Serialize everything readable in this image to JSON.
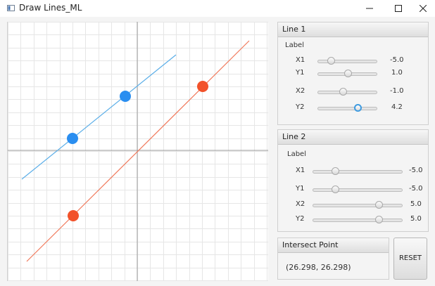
{
  "window": {
    "title": "Draw Lines_ML"
  },
  "line1": {
    "title": "Line 1",
    "label": "Label",
    "color": "#2a8ef0",
    "sliders": [
      {
        "name": "X1",
        "value_text": "-5.0",
        "value": -5.0,
        "position": 0.17
      },
      {
        "name": "Y1",
        "value_text": "1.0",
        "value": 1.0,
        "position": 0.52
      },
      {
        "name": "X2",
        "value_text": "-1.0",
        "value": -1.0,
        "position": 0.44
      },
      {
        "name": "Y2",
        "value_text": "4.2",
        "value": 4.2,
        "position": 0.7
      }
    ]
  },
  "line2": {
    "title": "Line 2",
    "label": "Label",
    "color": "#f2522a",
    "sliders": [
      {
        "name": "X1",
        "value_text": "-5.0",
        "value": -5.0,
        "position": 0.18
      },
      {
        "name": "Y1",
        "value_text": "-5.0",
        "value": -5.0,
        "position": 0.18
      },
      {
        "name": "X2",
        "value_text": "5.0",
        "value": 5.0,
        "position": 0.83
      },
      {
        "name": "Y2",
        "value_text": "5.0",
        "value": 5.0,
        "position": 0.83
      }
    ]
  },
  "intersect": {
    "title": "Intersect Point",
    "value": "(26.298, 26.298)"
  },
  "reset": {
    "label": "RESET"
  },
  "plot": {
    "background": "#ffffff",
    "grid_color": "#e6e6e6",
    "axis_color": "#9a9a9a",
    "blue_line": {
      "color": "#5aaee8",
      "point_color": "#2a8ef0"
    },
    "orange_line": {
      "color": "#f0785a",
      "point_color": "#f2522a"
    }
  }
}
